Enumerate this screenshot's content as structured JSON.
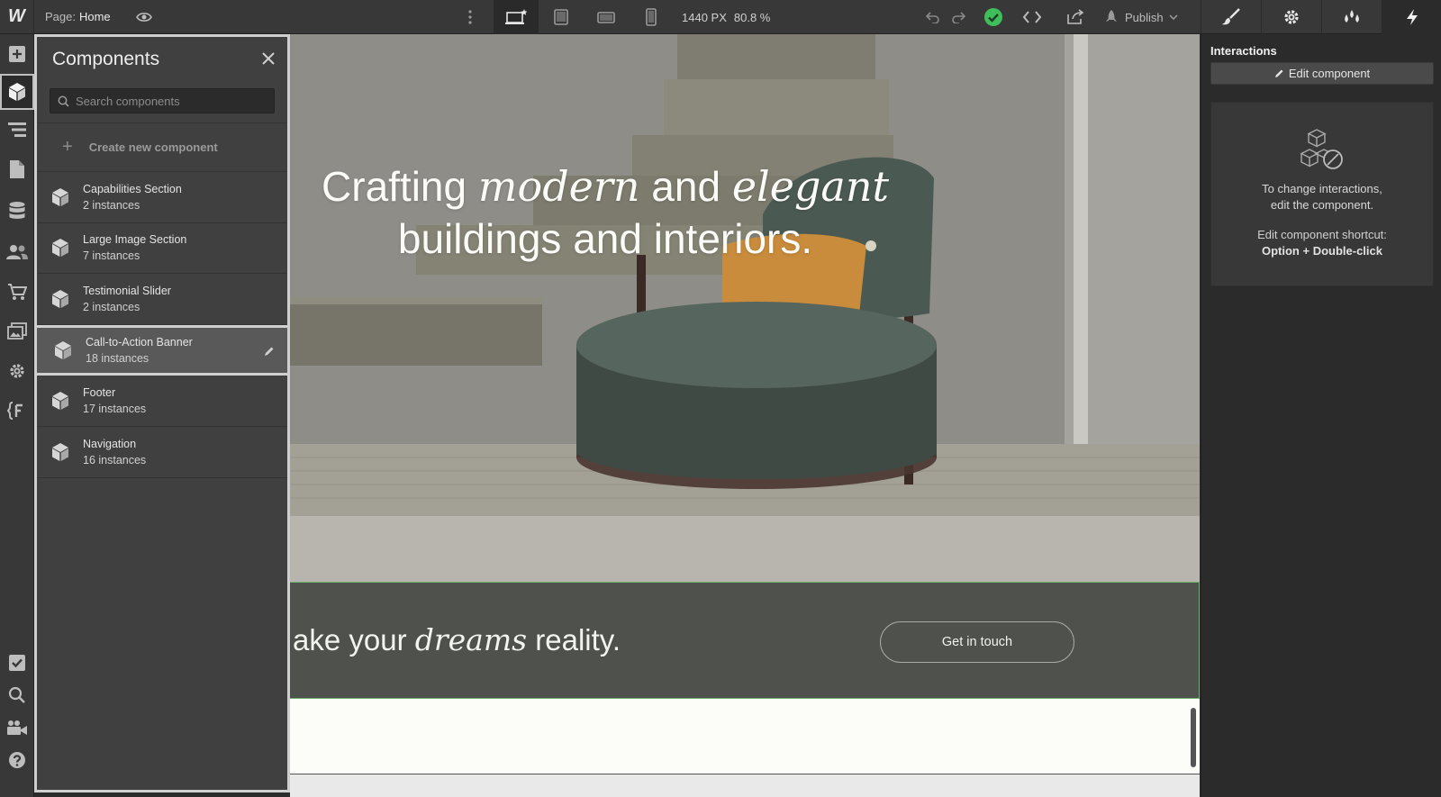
{
  "topbar": {
    "logo": "W",
    "page_prefix": "Page:",
    "page_name": "Home",
    "viewport_width": "1440 PX",
    "zoom": "80.8 %",
    "publish_label": "Publish",
    "devices": [
      "desktop-star",
      "tablet",
      "mobile-landscape",
      "mobile-portrait"
    ],
    "status_color": "#3fbf5b"
  },
  "rail": {
    "items": [
      "add-icon",
      "components-icon",
      "navigator-icon",
      "pages-icon",
      "cms-icon",
      "users-icon",
      "ecommerce-icon",
      "assets-icon",
      "settings-icon",
      "variables-icon",
      "audit-icon",
      "search-icon",
      "video-icon",
      "help-icon"
    ]
  },
  "components_panel": {
    "title": "Components",
    "search_placeholder": "Search components",
    "create_label": "Create new component",
    "items": [
      {
        "name": "Capabilities Section",
        "count": "2 instances"
      },
      {
        "name": "Large Image Section",
        "count": "7 instances"
      },
      {
        "name": "Testimonial Slider",
        "count": "2 instances"
      },
      {
        "name": "Call-to-Action Banner",
        "count": "18 instances"
      },
      {
        "name": "Footer",
        "count": "17 instances"
      },
      {
        "name": "Navigation",
        "count": "16 instances"
      }
    ]
  },
  "canvas": {
    "hero_line1_a": "Crafting ",
    "hero_line1_b": "modern",
    "hero_line1_c": " and ",
    "hero_line1_d": "elegant",
    "hero_line2": "buildings and interiors.",
    "cta_a": "ake your ",
    "cta_b": "dreams",
    "cta_c": " reality.",
    "cta_button": "Get in touch"
  },
  "right_panel": {
    "title": "Interactions",
    "edit_button": "Edit component",
    "info_line1": "To change interactions,",
    "info_line2": "edit the component.",
    "shortcut_label": "Edit component shortcut:",
    "shortcut_keys": "Option + Double-click"
  }
}
